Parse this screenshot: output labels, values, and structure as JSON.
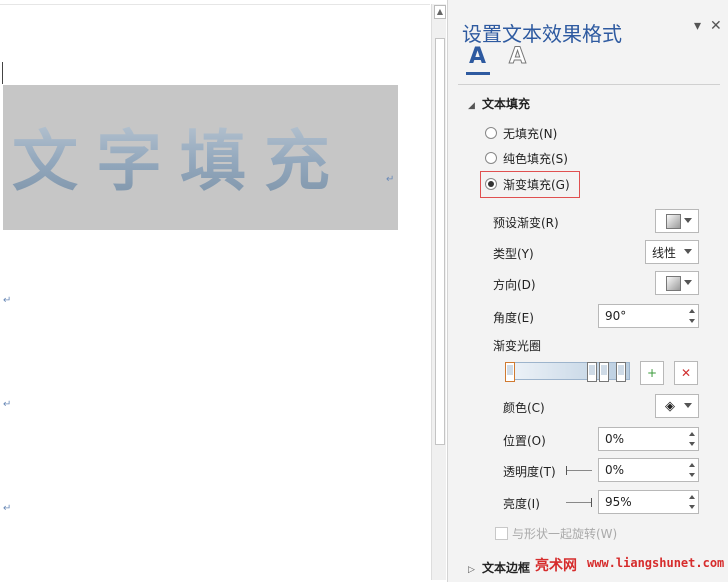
{
  "document": {
    "big_text": "文字填充",
    "paragraph_mark": "↵"
  },
  "pane": {
    "title": "设置文本效果格式",
    "pin_glyph": "▾",
    "close_glyph": "✕",
    "tab_fill_glyph": "A",
    "tab_outline_glyph": "A",
    "text_fill_section": {
      "label": "文本填充",
      "options": [
        {
          "label": "无填充(N)",
          "selected": false
        },
        {
          "label": "纯色填充(S)",
          "selected": false
        },
        {
          "label": "渐变填充(G)",
          "selected": true
        }
      ]
    },
    "preset_gradient": {
      "label": "预设渐变(R)"
    },
    "type": {
      "label": "类型(Y)",
      "value": "线性"
    },
    "direction": {
      "label": "方向(D)"
    },
    "angle": {
      "label": "角度(E)",
      "value": "90°"
    },
    "gradient_stops": {
      "label": "渐变光圈",
      "add_glyph": "+",
      "remove_glyph": "✕"
    },
    "color": {
      "label": "颜色(C)",
      "icon": "paint-bucket-icon"
    },
    "position": {
      "label": "位置(O)",
      "value": "0%"
    },
    "transparency": {
      "label": "透明度(T)",
      "value": "0%",
      "level": 0
    },
    "brightness": {
      "label": "亮度(I)",
      "value": "95%",
      "level": 0.95
    },
    "rotate_with_shape": {
      "label": "与形状一起旋转(W)",
      "enabled": false
    },
    "text_border_section": {
      "label": "文本边框"
    }
  },
  "watermark": {
    "site_name": "亮术网",
    "url": "www.liangshunet.com"
  },
  "colors": {
    "accent": "#2e5aa0",
    "highlight_border": "#e05050",
    "watermark": "#d62c2c"
  }
}
